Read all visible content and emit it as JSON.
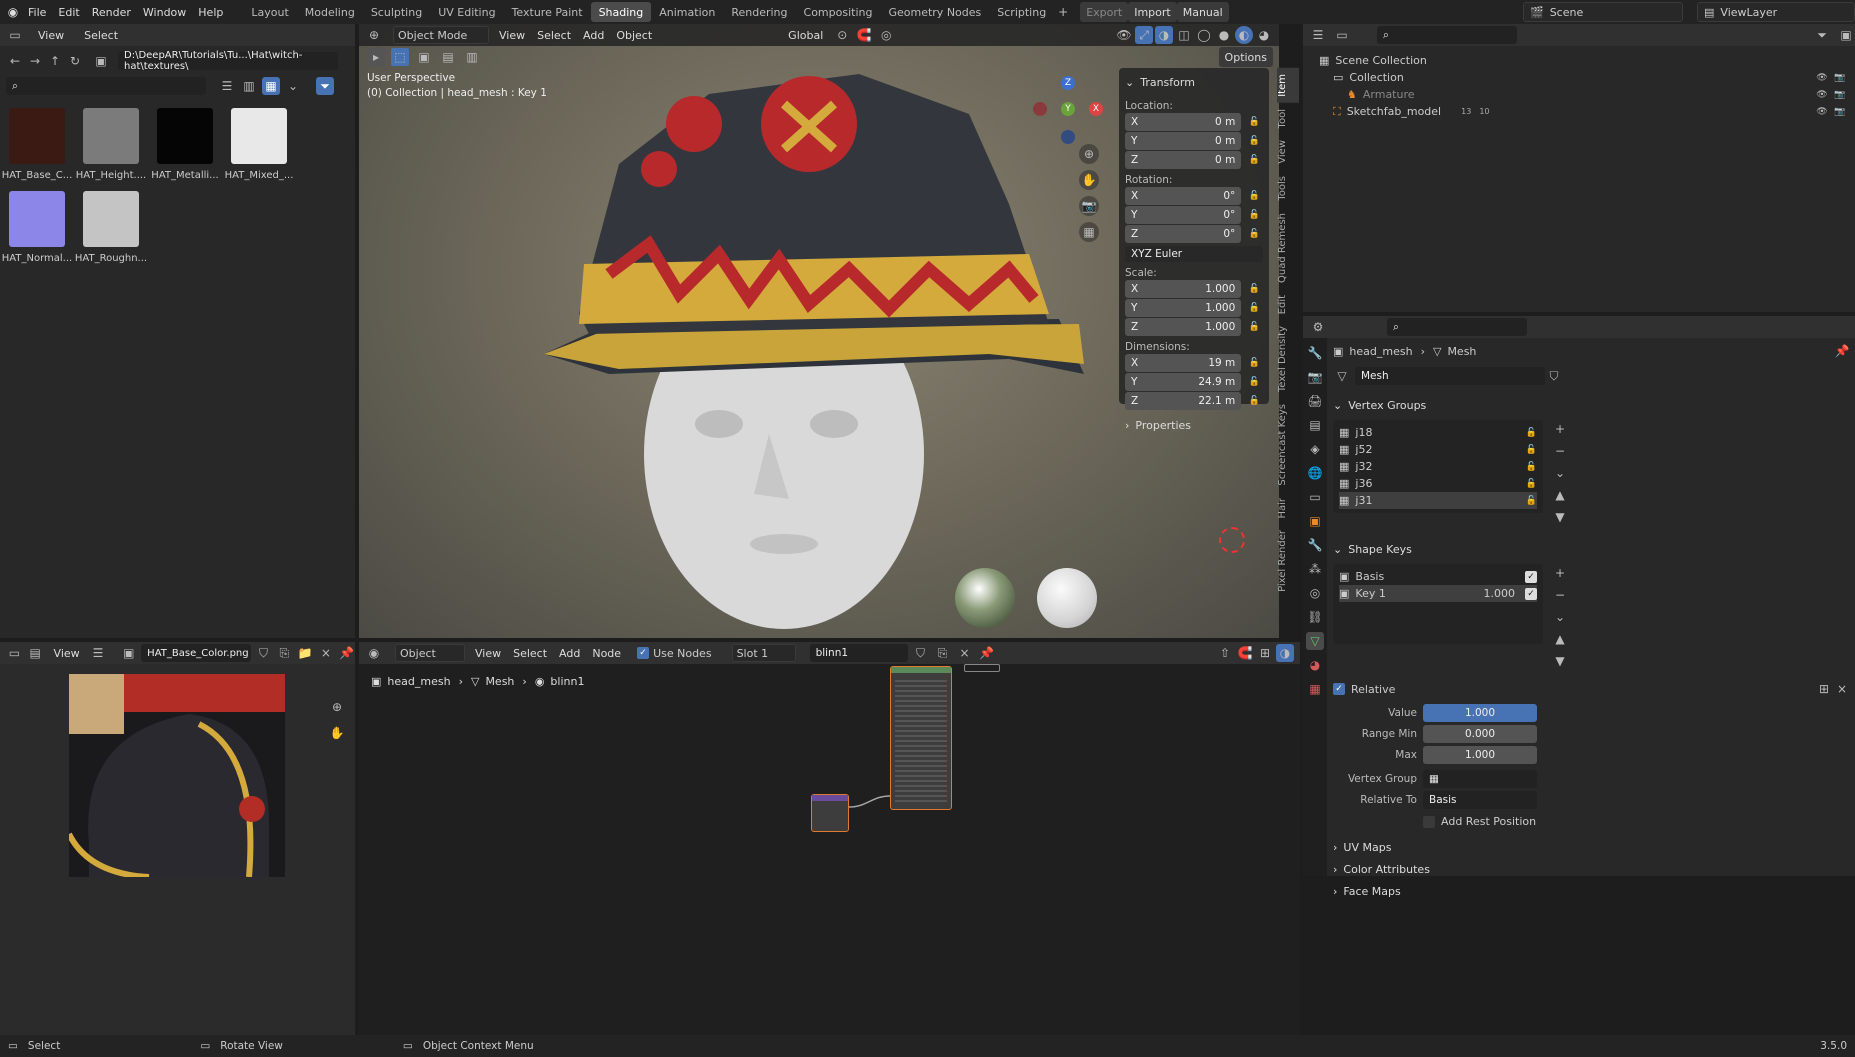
{
  "topbar": {
    "menus": [
      "File",
      "Edit",
      "Render",
      "Window",
      "Help"
    ],
    "workspaces": [
      "Layout",
      "Modeling",
      "Sculpting",
      "UV Editing",
      "Texture Paint",
      "Shading",
      "Animation",
      "Rendering",
      "Compositing",
      "Geometry Nodes",
      "Scripting"
    ],
    "active_workspace": "Shading",
    "export_label": "Export",
    "import_label": "Import",
    "manual_label": "Manual",
    "scene": "Scene",
    "view_layer": "ViewLayer"
  },
  "file_browser": {
    "view": "View",
    "select": "Select",
    "path": "D:\\DeepAR\\Tutorials\\Tu...\\Hat\\witch-hat\\textures\\",
    "files": [
      {
        "name": "HAT_Base_C...",
        "color": "#3a1a12"
      },
      {
        "name": "HAT_Height....",
        "color": "#7b7b7b"
      },
      {
        "name": "HAT_Metalli...",
        "color": "#050505"
      },
      {
        "name": "HAT_Mixed_...",
        "color": "#e8e8e8"
      },
      {
        "name": "HAT_Normal...",
        "color": "#8c86e8"
      },
      {
        "name": "HAT_Roughn...",
        "color": "#c4c4c4"
      }
    ]
  },
  "viewport": {
    "mode": "Object Mode",
    "menus": [
      "View",
      "Select",
      "Add",
      "Object"
    ],
    "orientation": "Global",
    "options": "Options",
    "perspective": "User Perspective",
    "info": "(0) Collection | head_mesh : Key 1",
    "gizmo": {
      "z": "Z",
      "y": "Y",
      "x": "X"
    }
  },
  "transform": {
    "title": "Transform",
    "location_label": "Location:",
    "location": [
      {
        "a": "X",
        "v": "0 m"
      },
      {
        "a": "Y",
        "v": "0 m"
      },
      {
        "a": "Z",
        "v": "0 m"
      }
    ],
    "rotation_label": "Rotation:",
    "rotation": [
      {
        "a": "X",
        "v": "0°"
      },
      {
        "a": "Y",
        "v": "0°"
      },
      {
        "a": "Z",
        "v": "0°"
      }
    ],
    "rotation_mode": "XYZ Euler",
    "scale_label": "Scale:",
    "scale": [
      {
        "a": "X",
        "v": "1.000"
      },
      {
        "a": "Y",
        "v": "1.000"
      },
      {
        "a": "Z",
        "v": "1.000"
      }
    ],
    "dimensions_label": "Dimensions:",
    "dimensions": [
      {
        "a": "X",
        "v": "19 m"
      },
      {
        "a": "Y",
        "v": "24.9 m"
      },
      {
        "a": "Z",
        "v": "22.1 m"
      }
    ],
    "properties": "Properties"
  },
  "sidetabs": [
    "Item",
    "Tool",
    "View",
    "Tools",
    "Quad Remesh",
    "Edit",
    "Texel Density",
    "Screencast Keys",
    "Hair",
    "Pixel Render"
  ],
  "outliner": {
    "root": "Scene Collection",
    "items": [
      {
        "name": "Collection",
        "indent": 1
      },
      {
        "name": "Armature",
        "indent": 2
      },
      {
        "name": "Sketchfab_model",
        "indent": 1,
        "badge1": "13",
        "badge2": "10"
      }
    ]
  },
  "properties": {
    "breadcrumb_obj": "head_mesh",
    "breadcrumb_data": "Mesh",
    "data_name": "Mesh",
    "vertex_groups_title": "Vertex Groups",
    "vertex_groups": [
      "j18",
      "j52",
      "j32",
      "j36",
      "j31"
    ],
    "shape_keys_title": "Shape Keys",
    "shape_keys": [
      {
        "name": "Basis",
        "value": ""
      },
      {
        "name": "Key 1",
        "value": "1.000"
      }
    ],
    "relative": "Relative",
    "value_label": "Value",
    "value": "1.000",
    "range_min_label": "Range Min",
    "range_min": "0.000",
    "max_label": "Max",
    "max": "1.000",
    "vertex_group_label": "Vertex Group",
    "relative_to_label": "Relative To",
    "relative_to": "Basis",
    "add_rest": "Add Rest Position",
    "uv_maps": "UV Maps",
    "color_attributes": "Color Attributes",
    "face_maps": "Face Maps"
  },
  "image_editor": {
    "view": "View",
    "image": "HAT_Base_Color.png"
  },
  "node_editor": {
    "mode": "Object",
    "menus": [
      "View",
      "Select",
      "Add",
      "Node"
    ],
    "use_nodes": "Use Nodes",
    "slot": "Slot 1",
    "material": "blinn1",
    "bc_obj": "head_mesh",
    "bc_mesh": "Mesh",
    "bc_mat": "blinn1"
  },
  "status": {
    "select": "Select",
    "rotate": "Rotate View",
    "context": "Object Context Menu",
    "version": "3.5.0"
  }
}
